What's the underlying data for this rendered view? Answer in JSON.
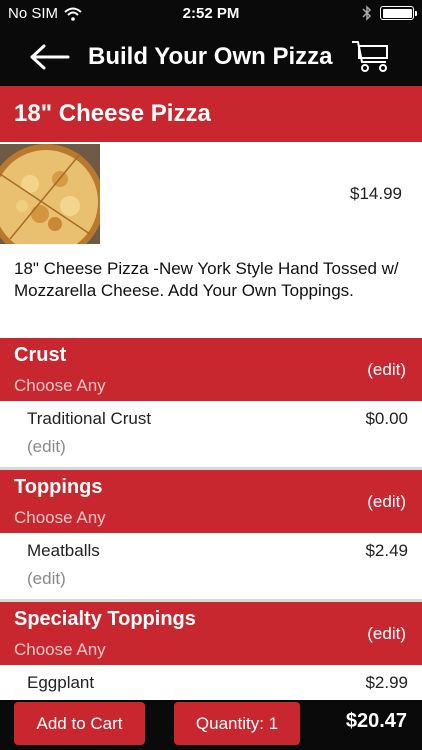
{
  "status_bar": {
    "carrier": "No SIM",
    "time": "2:52 PM"
  },
  "nav": {
    "title": "Build Your Own Pizza"
  },
  "item": {
    "title": "18\" Cheese Pizza",
    "price": "$14.99",
    "description": "18\" Cheese Pizza -New York Style Hand Tossed w/ Mozzarella Cheese. Add Your Own Toppings."
  },
  "sections": [
    {
      "title": "Crust",
      "subtitle": "Choose Any",
      "edit_label": "(edit)",
      "options": [
        {
          "name": "Traditional Crust",
          "price": "$0.00",
          "edit_label": "(edit)"
        }
      ]
    },
    {
      "title": "Toppings",
      "subtitle": "Choose Any",
      "edit_label": "(edit)",
      "options": [
        {
          "name": "Meatballs",
          "price": "$2.49",
          "edit_label": "(edit)"
        }
      ]
    },
    {
      "title": "Specialty Toppings",
      "subtitle": "Choose Any",
      "edit_label": "(edit)",
      "options": [
        {
          "name": "Eggplant",
          "price": "$2.99"
        }
      ]
    }
  ],
  "bottom_bar": {
    "add_to_cart_label": "Add to Cart",
    "quantity_label": "Quantity: 1",
    "total": "$20.47"
  },
  "colors": {
    "accent": "#c9272f",
    "bar": "#0a0a0a",
    "subtitle": "#f4c6c6",
    "muted": "#8a8a8a"
  },
  "icons": [
    "wifi-icon",
    "bluetooth-icon",
    "battery-icon",
    "back-arrow-icon",
    "cart-icon"
  ]
}
